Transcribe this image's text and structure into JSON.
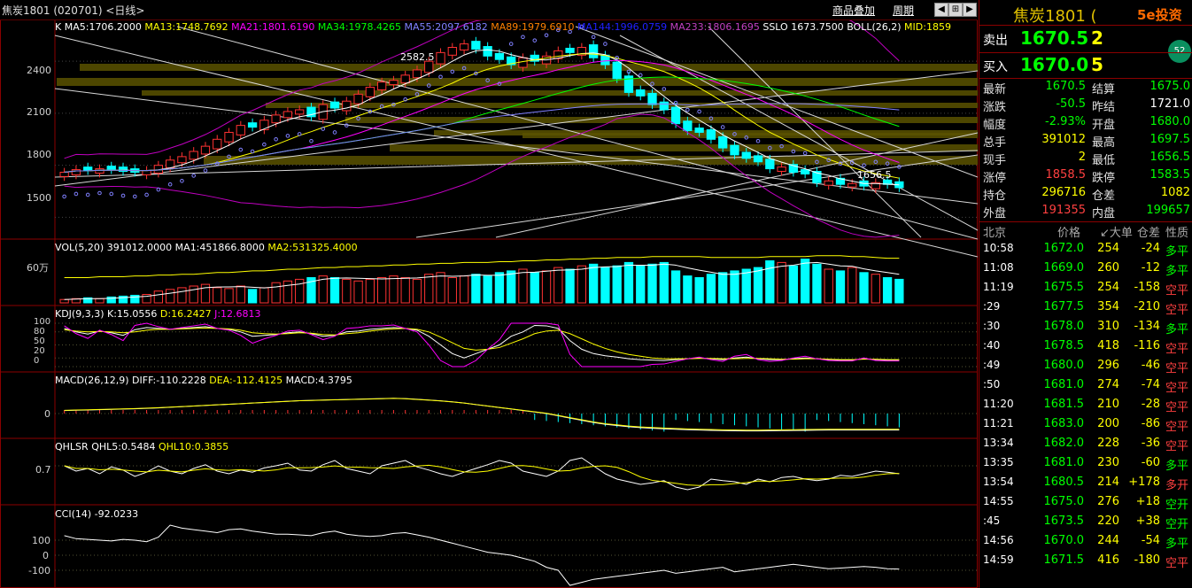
{
  "titlebar": {
    "name": "焦炭1801 (020701) <日线>",
    "overlay_link": "商品叠加",
    "period_link": "周期"
  },
  "main": {
    "k_label": "K",
    "ma": [
      {
        "text": "MA5:1706.2000",
        "color": "#ffffff"
      },
      {
        "text": "MA13:1748.7692",
        "color": "#ffff00"
      },
      {
        "text": "MA21:1801.6190",
        "color": "#ff00ff"
      },
      {
        "text": "MA34:1978.4265",
        "color": "#00ff00"
      },
      {
        "text": "MA55:2097.6182",
        "color": "#8080ff"
      },
      {
        "text": "MA89:1979.6910",
        "color": "#ff8000"
      },
      {
        "text": "MA144:1996.0759",
        "color": "#2020ff"
      },
      {
        "text": "MA233:1806.1695",
        "color": "#c040c0"
      },
      {
        "text": "SSLO 1673.7500",
        "color": "#ffffff"
      },
      {
        "text": "BOLL(26,2)",
        "color": "#ffffff"
      },
      {
        "text": "MID:1859",
        "color": "#ffff00"
      }
    ],
    "y_ticks": [
      "2400",
      "2100",
      "1800",
      "1500"
    ],
    "high_marker": "2582.5",
    "low_marker": "1656.5"
  },
  "vol": {
    "label": "VOL(5,20) 391012.0000",
    "ma1": "MA1:451866.8000",
    "ma2": "MA2:531325.4000",
    "y_tick": "60万"
  },
  "kdj": {
    "label": "KDJ(9,3,3)",
    "k": "K:15.0556",
    "d": "D:16.2427",
    "j": "J:12.6813",
    "y_ticks": [
      "100",
      "80",
      "50",
      "20",
      "0"
    ]
  },
  "macd": {
    "label": "MACD(26,12,9)",
    "diff": "DIFF:-110.2228",
    "dea": "DEA:-112.4125",
    "macd": "MACD:4.3795",
    "y_tick": "0"
  },
  "qhlsr": {
    "label": "QHLSR",
    "q5": "QHL5:0.5484",
    "q10": "QHL10:0.3855",
    "y_tick": "0.7"
  },
  "cci": {
    "label": "CCI(14) -92.0233",
    "y_ticks": [
      "100",
      "0",
      "-100"
    ]
  },
  "chart_data": {
    "type": "candlestick",
    "closes": [
      1760,
      1775,
      1770,
      1780,
      1775,
      1765,
      1760,
      1770,
      1800,
      1830,
      1850,
      1880,
      1910,
      1950,
      1990,
      2030,
      2020,
      2060,
      2090,
      2110,
      2120,
      2080,
      2150,
      2130,
      2170,
      2210,
      2250,
      2280,
      2290,
      2320,
      2350,
      2400,
      2450,
      2480,
      2500,
      2470,
      2430,
      2410,
      2380,
      2420,
      2400,
      2430,
      2460,
      2450,
      2480,
      2420,
      2380,
      2300,
      2220,
      2200,
      2150,
      2120,
      2040,
      2000,
      1990,
      1950,
      1900,
      1860,
      1840,
      1820,
      1780,
      1790,
      1760,
      1750,
      1700,
      1710,
      1690,
      1695,
      1680,
      1700,
      1690,
      1671
    ],
    "up": [
      1,
      1,
      0,
      1,
      0,
      0,
      0,
      1,
      1,
      1,
      1,
      1,
      1,
      1,
      1,
      1,
      0,
      1,
      1,
      1,
      1,
      0,
      1,
      0,
      1,
      1,
      1,
      1,
      1,
      1,
      1,
      1,
      1,
      1,
      1,
      0,
      0,
      0,
      0,
      1,
      0,
      1,
      1,
      0,
      1,
      0,
      0,
      0,
      0,
      0,
      0,
      0,
      0,
      0,
      0,
      0,
      0,
      0,
      0,
      0,
      0,
      1,
      0,
      0,
      0,
      1,
      0,
      1,
      0,
      1,
      0,
      0
    ],
    "volume": [
      4,
      5,
      6,
      5,
      7,
      8,
      9,
      10,
      14,
      16,
      18,
      20,
      22,
      18,
      17,
      20,
      16,
      18,
      24,
      26,
      28,
      30,
      32,
      30,
      28,
      26,
      28,
      30,
      32,
      30,
      28,
      34,
      36,
      30,
      32,
      34,
      32,
      36,
      38,
      40,
      36,
      38,
      42,
      40,
      44,
      46,
      42,
      44,
      48,
      44,
      46,
      48,
      38,
      32,
      30,
      34,
      36,
      38,
      40,
      42,
      50,
      48,
      44,
      52,
      46,
      40,
      38,
      42,
      36,
      34,
      30,
      28
    ],
    "vol_ma": [
      30,
      30,
      30,
      31,
      31,
      31,
      32,
      32,
      33,
      33,
      34,
      34,
      35,
      36,
      36,
      37,
      38,
      38,
      39,
      40,
      40,
      41,
      42,
      42,
      43,
      43,
      44,
      44,
      45,
      45,
      46,
      46,
      47,
      47,
      48,
      48,
      48,
      49,
      49,
      50,
      50,
      51,
      51,
      52,
      52,
      53,
      53,
      54,
      54,
      54,
      55,
      55,
      55,
      55,
      55,
      54,
      54,
      54,
      54,
      54,
      55,
      55,
      55,
      55,
      56,
      56,
      56,
      55,
      55,
      54,
      53,
      53
    ],
    "kdj_k": [
      88,
      80,
      75,
      82,
      78,
      72,
      85,
      90,
      88,
      86,
      88,
      90,
      92,
      88,
      86,
      80,
      70,
      72,
      74,
      78,
      80,
      76,
      70,
      72,
      80,
      82,
      86,
      88,
      90,
      88,
      84,
      70,
      50,
      30,
      20,
      30,
      40,
      50,
      70,
      80,
      95,
      94,
      88,
      60,
      40,
      30,
      25,
      22,
      18,
      16,
      15,
      14,
      16,
      18,
      20,
      18,
      16,
      20,
      22,
      18,
      16,
      16,
      18,
      20,
      18,
      16,
      15,
      15,
      18,
      16,
      15,
      15
    ],
    "kdj_d": [
      85,
      82,
      80,
      81,
      80,
      78,
      80,
      84,
      86,
      86,
      87,
      88,
      89,
      88,
      87,
      84,
      78,
      76,
      75,
      76,
      78,
      77,
      74,
      73,
      76,
      78,
      82,
      85,
      87,
      88,
      86,
      80,
      68,
      55,
      42,
      38,
      40,
      44,
      54,
      64,
      76,
      82,
      84,
      76,
      64,
      52,
      42,
      34,
      28,
      24,
      20,
      18,
      18,
      18,
      19,
      19,
      18,
      18,
      19,
      19,
      18,
      17,
      17,
      18,
      18,
      17,
      16,
      16,
      17,
      17,
      16,
      16
    ],
    "macd_diff": [
      20,
      22,
      24,
      26,
      28,
      30,
      32,
      35,
      38,
      42,
      46,
      50,
      54,
      58,
      62,
      66,
      70,
      74,
      78,
      82,
      86,
      88,
      90,
      92,
      94,
      96,
      98,
      100,
      102,
      100,
      95,
      90,
      85,
      78,
      70,
      60,
      50,
      40,
      30,
      20,
      10,
      0,
      -15,
      -30,
      -45,
      -60,
      -72,
      -80,
      -88,
      -94,
      -98,
      -102,
      -105,
      -108,
      -110,
      -112,
      -114,
      -115,
      -116,
      -116,
      -115,
      -114,
      -113,
      -112,
      -111,
      -110,
      -110,
      -110,
      -110,
      -110,
      -110,
      -110
    ],
    "qhl5": [
      0.7,
      0.6,
      0.65,
      0.55,
      0.68,
      0.62,
      0.5,
      0.58,
      0.7,
      0.6,
      0.55,
      0.65,
      0.72,
      0.6,
      0.55,
      0.62,
      0.58,
      0.66,
      0.7,
      0.75,
      0.62,
      0.6,
      0.72,
      0.8,
      0.65,
      0.6,
      0.55,
      0.7,
      0.75,
      0.8,
      0.68,
      0.62,
      0.55,
      0.5,
      0.58,
      0.65,
      0.72,
      0.8,
      0.75,
      0.6,
      0.55,
      0.5,
      0.6,
      0.8,
      0.85,
      0.7,
      0.55,
      0.45,
      0.4,
      0.35,
      0.38,
      0.42,
      0.3,
      0.25,
      0.3,
      0.45,
      0.42,
      0.4,
      0.35,
      0.45,
      0.4,
      0.48,
      0.5,
      0.45,
      0.42,
      0.45,
      0.52,
      0.5,
      0.55,
      0.6,
      0.58,
      0.55
    ],
    "cci": [
      130,
      110,
      105,
      100,
      95,
      105,
      100,
      90,
      120,
      200,
      180,
      170,
      160,
      150,
      170,
      175,
      160,
      150,
      140,
      140,
      135,
      130,
      150,
      160,
      140,
      130,
      125,
      130,
      145,
      150,
      135,
      120,
      100,
      80,
      60,
      40,
      20,
      10,
      0,
      -20,
      -40,
      -80,
      -100,
      -200,
      -180,
      -160,
      -150,
      -140,
      -130,
      -120,
      -110,
      -100,
      -120,
      -110,
      -100,
      -90,
      -80,
      -110,
      -100,
      -90,
      -80,
      -70,
      -60,
      -70,
      -80,
      -90,
      -85,
      -80,
      -75,
      -80,
      -90,
      -92
    ]
  },
  "panel": {
    "title": "焦炭1801 (",
    "logo": "5e投资",
    "ask_label": "卖出",
    "ask_price": "1670.5",
    "ask_vol": "2",
    "bid_label": "买入",
    "bid_price": "1670.0",
    "bid_vol": "5",
    "badge": "52",
    "quotes": [
      {
        "l1": "最新",
        "v1": "1670.5",
        "c1": "#00ff00",
        "l2": "结算",
        "v2": "1675.0",
        "c2": "#00ff00"
      },
      {
        "l1": "涨跌",
        "v1": "-50.5",
        "c1": "#00ff00",
        "l2": "昨结",
        "v2": "1721.0",
        "c2": "#ffffff"
      },
      {
        "l1": "幅度",
        "v1": "-2.93%",
        "c1": "#00ff00",
        "l2": "开盘",
        "v2": "1680.0",
        "c2": "#00ff00"
      },
      {
        "l1": "总手",
        "v1": "391012",
        "c1": "#ffff00",
        "l2": "最高",
        "v2": "1697.5",
        "c2": "#00ff00"
      },
      {
        "l1": "现手",
        "v1": "2",
        "c1": "#ffff00",
        "l2": "最低",
        "v2": "1656.5",
        "c2": "#00ff00"
      },
      {
        "l1": "涨停",
        "v1": "1858.5",
        "c1": "#ff4040",
        "l2": "跌停",
        "v2": "1583.5",
        "c2": "#00ff00"
      },
      {
        "l1": "持仓",
        "v1": "296716",
        "c1": "#ffff00",
        "l2": "仓差",
        "v2": "1082",
        "c2": "#ffff00"
      },
      {
        "l1": "外盘",
        "v1": "191355",
        "c1": "#ff4040",
        "l2": "内盘",
        "v2": "199657",
        "c2": "#00ff00"
      }
    ],
    "trade_headers": [
      "北京",
      "价格",
      "↙大单",
      "仓差",
      "性质"
    ],
    "trades": [
      {
        "t": "10:58",
        "p": "1672.0",
        "v": "254",
        "d": "-24",
        "n": "多平",
        "nc": "#00ff00"
      },
      {
        "t": "11:08",
        "p": "1669.0",
        "v": "260",
        "d": "-12",
        "n": "多平",
        "nc": "#00ff00"
      },
      {
        "t": "11:19",
        "p": "1675.5",
        "v": "254",
        "d": "-158",
        "n": "空平",
        "nc": "#ff4040"
      },
      {
        "t": ":29",
        "p": "1677.5",
        "v": "354",
        "d": "-210",
        "n": "空平",
        "nc": "#ff4040"
      },
      {
        "t": ":30",
        "p": "1678.0",
        "v": "310",
        "d": "-134",
        "n": "多平",
        "nc": "#00ff00"
      },
      {
        "t": ":40",
        "p": "1678.5",
        "v": "418",
        "d": "-116",
        "n": "空平",
        "nc": "#ff4040"
      },
      {
        "t": ":49",
        "p": "1680.0",
        "v": "296",
        "d": "-46",
        "n": "空平",
        "nc": "#ff4040"
      },
      {
        "t": ":50",
        "p": "1681.0",
        "v": "274",
        "d": "-74",
        "n": "空平",
        "nc": "#ff4040"
      },
      {
        "t": "11:20",
        "p": "1681.5",
        "v": "210",
        "d": "-28",
        "n": "空平",
        "nc": "#ff4040"
      },
      {
        "t": "11:21",
        "p": "1683.0",
        "v": "200",
        "d": "-86",
        "n": "空平",
        "nc": "#ff4040"
      },
      {
        "t": "13:34",
        "p": "1682.0",
        "v": "228",
        "d": "-36",
        "n": "空平",
        "nc": "#ff4040"
      },
      {
        "t": "13:35",
        "p": "1681.0",
        "v": "230",
        "d": "-60",
        "n": "多平",
        "nc": "#00ff00"
      },
      {
        "t": "13:54",
        "p": "1680.5",
        "v": "214",
        "d": "+178",
        "n": "多开",
        "nc": "#ff4040"
      },
      {
        "t": "14:55",
        "p": "1675.0",
        "v": "276",
        "d": "+18",
        "n": "空开",
        "nc": "#00ff00"
      },
      {
        "t": ":45",
        "p": "1673.5",
        "v": "220",
        "d": "+38",
        "n": "空开",
        "nc": "#00ff00"
      },
      {
        "t": "14:56",
        "p": "1670.0",
        "v": "244",
        "d": "-54",
        "n": "多平",
        "nc": "#00ff00"
      },
      {
        "t": "14:59",
        "p": "1671.5",
        "v": "416",
        "d": "-180",
        "n": "空平",
        "nc": "#ff4040"
      }
    ]
  }
}
